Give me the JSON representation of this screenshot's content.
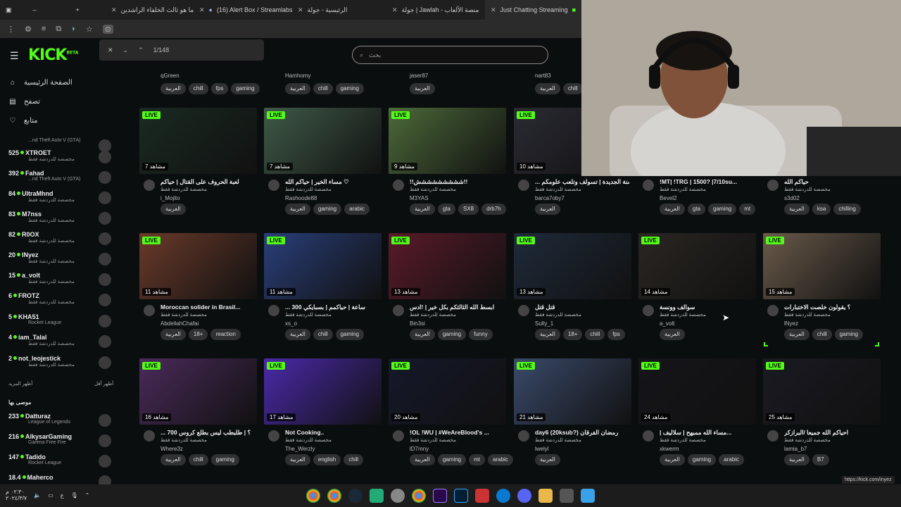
{
  "browser": {
    "tabs": [
      {
        "title": "ما هو ثالث الخلفاء الراشدين",
        "icon": "google-icon"
      },
      {
        "title": "(16) Alert Box / Streamlabs",
        "icon": "streamlabs-icon"
      },
      {
        "title": "الرئيسية - جولة",
        "icon": "page-icon"
      },
      {
        "title": "جولة | Jawlah - منصة الألعاب",
        "icon": "page-icon"
      },
      {
        "title": "Just Chatting Streaming",
        "icon": "kick-icon",
        "active": true
      }
    ],
    "new_tab": "+",
    "find": {
      "count": "1/148"
    },
    "status_url": "https://kick.com/inyez"
  },
  "header": {
    "logo": "KICK",
    "logo_badge": "BETA",
    "search_placeholder": "بحث"
  },
  "nav": [
    {
      "label": "الصفحة الرئيسية",
      "icon": "home-icon"
    },
    {
      "label": "تصفح",
      "icon": "browse-icon"
    },
    {
      "label": "متابع",
      "icon": "heart-icon"
    }
  ],
  "following_channels": [
    {
      "count": "",
      "name": "",
      "category": "...nd Theft Auto V (GTA)"
    },
    {
      "count": "525",
      "name": "XTROET",
      "category": "مخصصة للدردشة فقط"
    },
    {
      "count": "392",
      "name": "Fahad",
      "category": "...nd Theft Auto V (GTA)"
    },
    {
      "count": "84",
      "name": "UltraMhnd",
      "category": "مخصصة للدردشة فقط"
    },
    {
      "count": "83",
      "name": "M7nss",
      "category": "مخصصة للدردشة فقط"
    },
    {
      "count": "82",
      "name": "R0OX",
      "category": "مخصصة للدردشة فقط"
    },
    {
      "count": "20",
      "name": "lNyez",
      "category": "مخصصة للدردشة فقط"
    },
    {
      "count": "15",
      "name": "a_volt",
      "category": "مخصصة للدردشة فقط"
    },
    {
      "count": "6",
      "name": "FROTZ",
      "category": "مخصصة للدردشة فقط"
    },
    {
      "count": "5",
      "name": "KHA51",
      "category": "Rocket League"
    },
    {
      "count": "4",
      "name": "iam_Talal",
      "category": "مخصصة للدردشة فقط"
    },
    {
      "count": "2",
      "name": "not_leojestick",
      "category": "مخصصة للدردشة فقط"
    }
  ],
  "show_more": "أظهر المزيد",
  "show_less": "أظهر أقل",
  "recommended_heading": "موصى بها",
  "recommended_channels": [
    {
      "count": "233",
      "name": "Datturaz",
      "category": "League of Legends"
    },
    {
      "count": "216",
      "name": "AlkysarGaming",
      "category": "Garena Free Fire"
    },
    {
      "count": "147",
      "name": "Tadido",
      "category": "Rocket League"
    },
    {
      "count": "18.4",
      "name": "Maherco",
      "category": ""
    }
  ],
  "top_row": [
    {
      "user": "qGreen",
      "tags": [
        "العربية",
        "chill",
        "fps",
        "gaming"
      ]
    },
    {
      "user": "Hamhomy",
      "tags": [
        "العربية",
        "chill",
        "gaming"
      ]
    },
    {
      "user": "jaser87",
      "tags": [
        "العربية"
      ]
    },
    {
      "user": "nart83",
      "tags": [
        "العربية",
        "chill"
      ]
    }
  ],
  "streams": [
    {
      "live": "LIVE",
      "viewers": "7 مشاهد",
      "title": "لعبة الحروف على القتال | حياكم",
      "category": "مخصصة للدردشة فقط",
      "user": "i_Mojito",
      "tags": [
        "العربية"
      ],
      "thumb": "#1a2a22"
    },
    {
      "live": "LIVE",
      "viewers": "7 مشاهد",
      "title": "مساء الخير | حياكم الله ♡",
      "category": "مخصصة للدردشة فقط",
      "user": "Rashoode88",
      "tags": [
        "العربية",
        "gaming",
        "arabic"
      ],
      "thumb": "#3f5a48"
    },
    {
      "live": "LIVE",
      "viewers": "9 مشاهد",
      "title": "!!ششششششششش!!",
      "category": "مخصصة للدردشة فقط",
      "user": "M3YAS",
      "tags": [
        "العربية",
        "gta",
        "SX8",
        "drb7h"
      ],
      "thumb": "#4d6a3a"
    },
    {
      "live": "LIVE",
      "viewers": "10 مشاهد",
      "title": "... السنة الجديدة | تسولف وتلعب علومكم",
      "category": "مخصصة للدردشة فقط",
      "user": "barca7oby7",
      "tags": [
        "العربية"
      ],
      "thumb": "#2a2a33"
    },
    {
      "live": "",
      "viewers": "",
      "title": "!MT| !TRG | 1500? |7/10su...",
      "category": "مخصصة للدردشة فقط",
      "user": "Bevel2",
      "tags": [
        "العربية",
        "gta",
        "gaming",
        "mt"
      ],
      "thumb": ""
    },
    {
      "live": "",
      "viewers": "",
      "title": "حياكم الله",
      "category": "مخصصة للدردشة فقط",
      "user": "s3d02",
      "tags": [
        "العربية",
        "ksa",
        "chilling"
      ],
      "thumb": ""
    },
    {
      "live": "LIVE",
      "viewers": "11 مشاهد",
      "title": "Moroccan solider in Brasil...",
      "category": "مخصصة للدردشة فقط",
      "user": "AbdellahChafai",
      "tags": [
        "العربية",
        "18+",
        "reaction"
      ],
      "thumb": "#6a3a2a"
    },
    {
      "live": "LIVE",
      "viewers": "11 مشاهد",
      "title": "... 300 ساعة | حياكمم | بسبايكي",
      "category": "مخصصة للدردشة فقط",
      "user": "xs_o",
      "tags": [
        "العربية",
        "chill",
        "gaming"
      ],
      "thumb": "#2a3f7a"
    },
    {
      "live": "LIVE",
      "viewers": "13 مشاهد",
      "title": "ابسط الله الثالثكم بكل خير | !ادس",
      "category": "مخصصة للدردشة فقط",
      "user": "Bin3si",
      "tags": [
        "العربية",
        "gaming",
        "funny"
      ],
      "thumb": "#5a1a2a"
    },
    {
      "live": "LIVE",
      "viewers": "13 مشاهد",
      "title": "قتل قتل",
      "category": "مخصصة للدردشة فقط",
      "user": "Sully_1",
      "tags": [
        "العربية",
        "18+",
        "chill",
        "fps"
      ],
      "thumb": "#1f2a3a"
    },
    {
      "live": "LIVE",
      "viewers": "14 مشاهد",
      "title": "سوالف وونسة",
      "category": "مخصصة للدردشة فقط",
      "user": "a_volt",
      "tags": [
        "العربية"
      ],
      "thumb": "#2a2622"
    },
    {
      "live": "LIVE",
      "viewers": "15 مشاهد",
      "title": "؟ يقولون خلصت الاختبارات",
      "category": "مخصصة للدردشة فقط",
      "user": "lNyez",
      "tags": [
        "العربية",
        "chill",
        "gaming"
      ],
      "thumb": "#6a5a4a"
    },
    {
      "live": "LIVE",
      "viewers": "16 مشاهد",
      "title": "... 700 ؟ | طلبطب ليس بطلع كروس",
      "category": "مخصصة للدردشة فقط",
      "user": "Where3z",
      "tags": [
        "العربية",
        "chill",
        "gaming"
      ],
      "thumb": "#4a2a5a"
    },
    {
      "live": "LIVE",
      "viewers": "17 مشاهد",
      "title": "Not Cooking..",
      "category": "مخصصة للدردشة فقط",
      "user": "The_Werzly",
      "tags": [
        "العربية",
        "english",
        "chill"
      ],
      "thumb": "#4a2aaa"
    },
    {
      "live": "LIVE",
      "viewers": "20 مشاهد",
      "title": "!OL !WU | #WeAreBlood's ...",
      "category": "مخصصة للدردشة فقط",
      "user": "lD7mny",
      "tags": [
        "العربية",
        "gaming",
        "mt",
        "arabic"
      ],
      "thumb": "#15182a"
    },
    {
      "live": "LIVE",
      "viewers": "21 مشاهد",
      "title": "day6 (20ksub?) رمضان الفرقان",
      "category": "مخصصة للدردشة فقط",
      "user": "lwelyl",
      "tags": [
        "العربية"
      ],
      "thumb": "#3a4a6a"
    },
    {
      "live": "LIVE",
      "viewers": "24 مشاهد",
      "title": "| مساء الله ممبهح | سلاليف...",
      "category": "مخصصة للدردشة فقط",
      "user": "xkwerm",
      "tags": [
        "العربية",
        "gaming",
        "arabic"
      ],
      "thumb": "#15151a"
    },
    {
      "live": "LIVE",
      "viewers": "25 مشاهد",
      "title": "احياكم الله جميعا /البرازكر",
      "category": "مخصصة للدردشة فقط",
      "user": "lamia_b7",
      "tags": [
        "العربية",
        "B7"
      ],
      "thumb": "#1a1a22"
    }
  ],
  "taskbar": {
    "time": "٠٢:٣٠ م",
    "date": "٢٠٢٤/٣/٧",
    "lang": "ع"
  }
}
